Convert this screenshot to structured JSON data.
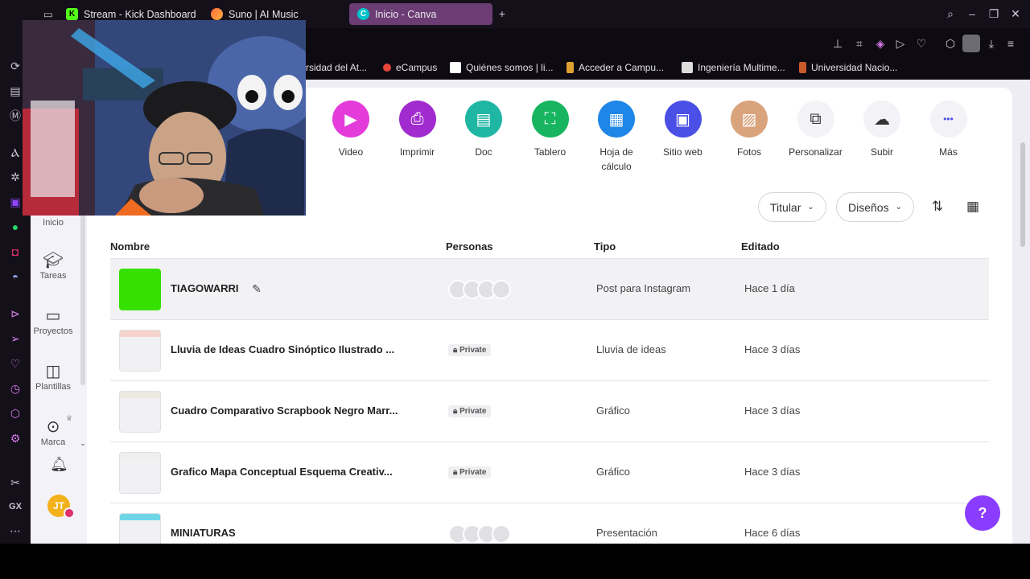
{
  "browser": {
    "tabs": [
      {
        "label": "Stream - Kick Dashboard",
        "favicon": "K",
        "color": "#53fc18"
      },
      {
        "label": "Suno | AI Music",
        "favicon": "",
        "color": "#ff6a3d"
      },
      {
        "label": "Inicio - Canva",
        "favicon": "C",
        "color": "#00c4cc"
      }
    ],
    "bookmarks": [
      {
        "label": "rsidad del At...",
        "color": "#555"
      },
      {
        "label": "eCampus",
        "color": "#e9443a"
      },
      {
        "label": "Quiénes somos | li...",
        "color": "#fff"
      },
      {
        "label": "Acceder a Campu...",
        "color": "#e0a030"
      },
      {
        "label": "Ingeniería Multime...",
        "color": "#ddd"
      },
      {
        "label": "Universidad Nacio...",
        "color": "#c85a2a"
      }
    ],
    "rail_bottom_label": "GX"
  },
  "quick_actions": [
    {
      "label": "Video",
      "color": "#e43cdb",
      "icon": "video-icon"
    },
    {
      "label": "Imprimir",
      "color": "#a12bcf",
      "icon": "print-icon"
    },
    {
      "label": "Doc",
      "color": "#1fb6a4",
      "icon": "doc-icon"
    },
    {
      "label": "Tablero",
      "color": "#17b55f",
      "icon": "whiteboard-icon"
    },
    {
      "label": "Hoja de\ncálculo",
      "color": "#1e86e6",
      "icon": "sheet-icon"
    },
    {
      "label": "Sitio web",
      "color": "#4a4fe6",
      "icon": "website-icon"
    },
    {
      "label": "Fotos",
      "color": "#d9a37c",
      "icon": "photos-icon"
    },
    {
      "label": "Personalizar",
      "color": "#f3f2f6",
      "icon": "custom-size-icon"
    },
    {
      "label": "Subir",
      "color": "#f3f2f6",
      "icon": "upload-icon"
    },
    {
      "label": "Más",
      "color": "#f3f2f6",
      "icon": "more-icon"
    }
  ],
  "filters": {
    "owner": "Titular",
    "type": "Diseños"
  },
  "sidebar": {
    "items": [
      "Inicio",
      "Tareas",
      "Proyectos",
      "Plantillas",
      "Marca"
    ],
    "account_initials": "JT"
  },
  "table": {
    "headers": {
      "name": "Nombre",
      "people": "Personas",
      "type": "Tipo",
      "edited": "Editado"
    },
    "rows": [
      {
        "name": "TIAGOWARRI",
        "type": "Post para Instagram",
        "edited": "Hace 1 día",
        "access": "",
        "thumb": "#36e000"
      },
      {
        "name": "Lluvia de Ideas Cuadro Sinóptico Ilustrado ...",
        "type": "Lluvia de ideas",
        "edited": "Hace 3 días",
        "access": "Private",
        "thumb": "#f6d4cc"
      },
      {
        "name": "Cuadro Comparativo Scrapbook Negro Marr...",
        "type": "Gráfico",
        "edited": "Hace 3 días",
        "access": "Private",
        "thumb": "#ece9e3"
      },
      {
        "name": "Grafico Mapa Conceptual Esquema Creativ...",
        "type": "Gráfico",
        "edited": "Hace 3 días",
        "access": "Private",
        "thumb": "#eeeeee"
      },
      {
        "name": "MINIATURAS",
        "type": "Presentación",
        "edited": "Hace 6 días",
        "access": "",
        "thumb": "#6fd6e8"
      }
    ]
  },
  "help": {
    "label": "?"
  }
}
